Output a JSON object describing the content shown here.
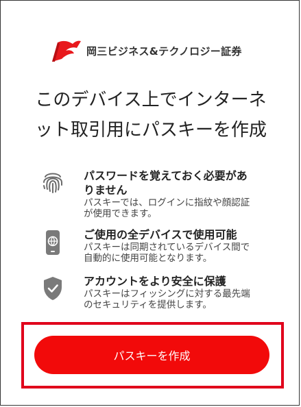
{
  "brand": {
    "name": "岡三ビジネス&テクノロジー証券",
    "logo_color": "#e8191d"
  },
  "title": {
    "line1": "このデバイス上でインターネ",
    "line2": "ット取引用にパスキーを作成"
  },
  "features": [
    {
      "icon": "fingerprint-icon",
      "title": "パスワードを覚えておく必要があ\nりません",
      "description": "パスキーでは、ログインに指紋や顔認証\nが使用できます。"
    },
    {
      "icon": "device-sync-icon",
      "title": "ご使用の全デバイスで使用可能",
      "description": "パスキーは同期されているデバイス間で\n自動的に使用可能となります。"
    },
    {
      "icon": "shield-check-icon",
      "title": "アカウントをより安全に保護",
      "description": "パスキーはフィッシングに対する最先端\nのセキュリティを提供します。"
    }
  ],
  "cta": {
    "label": "パスキーを作成",
    "color": "#f20a0a",
    "highlight_color": "#e0001b"
  }
}
